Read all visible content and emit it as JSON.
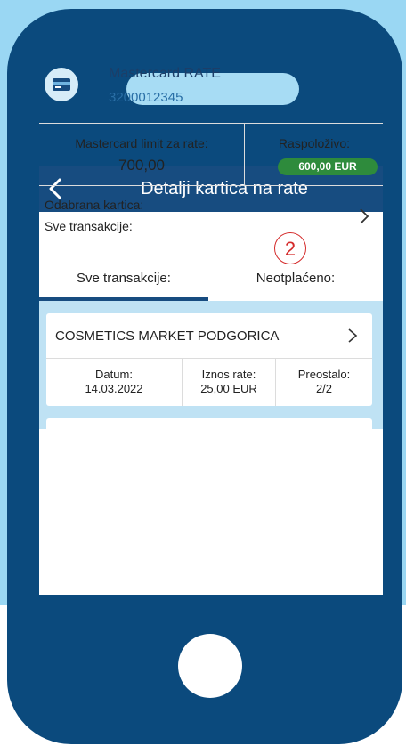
{
  "header": {
    "title": "Detalji kartica na rate"
  },
  "card": {
    "name": "Mastercard RATE",
    "number": "3200012345"
  },
  "limits": {
    "limit_label": "Mastercard limit za rate:",
    "limit_value": "700,00",
    "available_label": "Raspoloživo:",
    "available_value": "600,00 EUR"
  },
  "selection": {
    "card_label": "Odabrana kartica:",
    "transactions_label": "Sve transakcije:"
  },
  "annotation": {
    "step": "2"
  },
  "tabs": [
    {
      "label": "Sve transakcije:"
    },
    {
      "label": "Neotplaćeno:"
    }
  ],
  "transactions": [
    {
      "merchant": "COSMETICS MARKET PODGORICA",
      "date_label": "Datum:",
      "date": "14.03.2022",
      "amount_label": "Iznos rate:",
      "amount": "25,00 EUR",
      "remaining_label": "Preostalo:",
      "remaining": "2/2"
    }
  ],
  "colors": {
    "nav": "#174c80",
    "phone": "#0b4a7d",
    "background": "#9ad7f3",
    "available_pill": "#2e8b3c",
    "annotation": "#d42a2a"
  }
}
